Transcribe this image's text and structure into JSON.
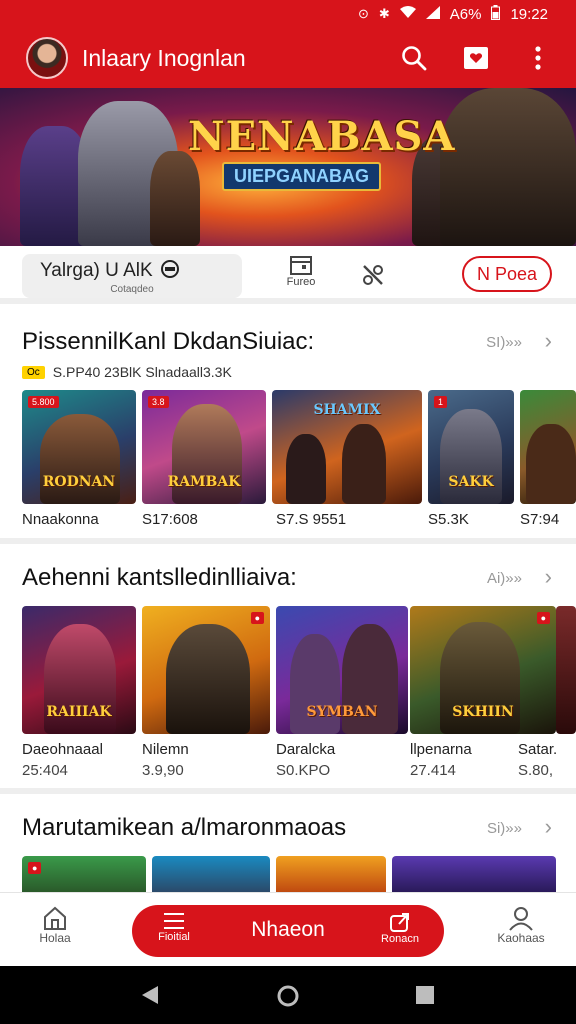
{
  "status_bar": {
    "battery": "A6%",
    "time": "19:22"
  },
  "app_bar": {
    "title": "Inlaary Inognlan"
  },
  "banner": {
    "title": "NENABASA",
    "subtitle": "UIEPGANABAG"
  },
  "filter_bar": {
    "search_main": "Yalrgа) U AlK",
    "search_sub": "Cotaqdeo",
    "filter_label": "Fureo",
    "pill_label": "N Poea"
  },
  "sections": [
    {
      "title": "PissennilKanl DkdanSiuiac:",
      "see_all": "SI)»»",
      "meta_tag": "Oc",
      "meta_text": "S.PP40 23BlK Slnadaall3.3K",
      "items": [
        {
          "badge": "5.800",
          "logo": "RODNAN",
          "caption": "Nnaakonna"
        },
        {
          "badge": "3.8",
          "logo": "RAMBAK",
          "caption": "S17:608"
        },
        {
          "badge": "",
          "logo": "SHAMIX",
          "caption": "S7.S 9551"
        },
        {
          "badge": "1",
          "logo": "SAKK",
          "caption": "S5.3K"
        },
        {
          "badge": "",
          "logo": "",
          "caption": "S7:94"
        }
      ]
    },
    {
      "title": "Aehenni kantslledinlliaiva:",
      "see_all": "Ai)»»",
      "items": [
        {
          "logo": "RAIIIAK",
          "caption": "Daeohnaaal",
          "sub": "25:404"
        },
        {
          "logo": "",
          "caption": "Nilemn",
          "sub": "3.9,90"
        },
        {
          "logo": "SYMBAN",
          "caption": "Daralcka",
          "sub": "S0.KPO"
        },
        {
          "logo": "SKHIIN",
          "caption": "llpenarna",
          "sub": "27.414"
        },
        {
          "logo": "",
          "caption": "Satar.",
          "sub": "S.80,"
        }
      ]
    },
    {
      "title": "Marutamikean a/lmaronmaoas",
      "see_all": "Si)»»"
    }
  ],
  "bottom_nav": {
    "home": "Holaa",
    "fab_left": "Fioitial",
    "fab_center": "Nhaeon",
    "fab_right": "Ronacn",
    "profile": "Kaohaas"
  },
  "colors": {
    "brand_red": "#d7141b",
    "divider": "#eeeeee"
  }
}
